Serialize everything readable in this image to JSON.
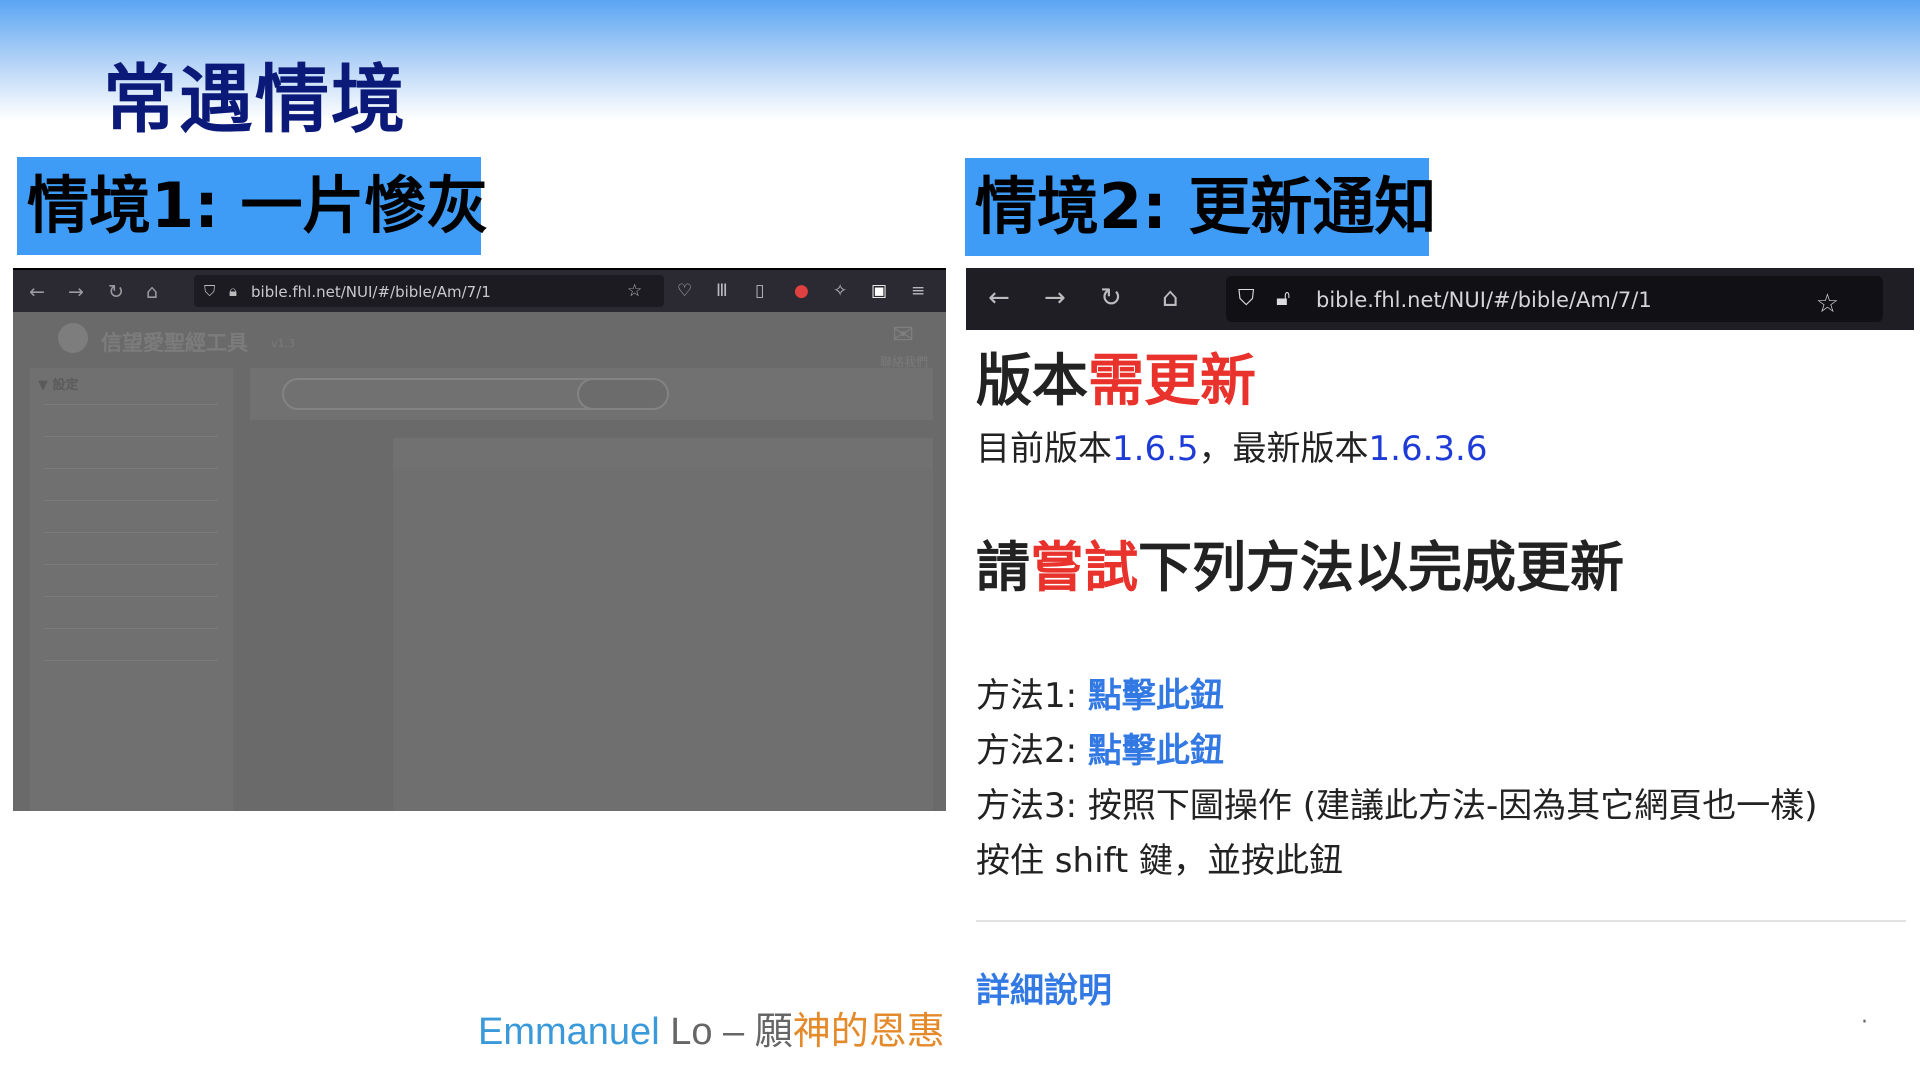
{
  "slide": {
    "title": "常遇情境",
    "label1": "情境1: 一片慘灰",
    "label2": "情境2: 更新通知"
  },
  "shot1": {
    "url": "bible.fhl.net/NUI/#/bible/Am/7/1",
    "app_title": "信望愛聖經工具",
    "version": "v1.3",
    "mail_label": "聯絡我們",
    "sidebar_title": "▼ 設定"
  },
  "shot2": {
    "url": "bible.fhl.net/NUI/#/bible/Am/7/1",
    "heading_prefix": "版本",
    "heading_red": "需更新",
    "current_label": "目前版本",
    "current_version": "1.6.5",
    "separator": "，最新版本",
    "latest_version": "1.6.3.6",
    "try_prefix": "請",
    "try_red": "嘗試",
    "try_suffix": "下列方法以完成更新",
    "method1_label": "方法1: ",
    "method1_link": "點擊此鈕",
    "method2_label": "方法2: ",
    "method2_link": "點擊此鈕",
    "method3": "方法3: 按照下圖操作 (建議此方法-因為其它網頁也一樣)",
    "shift_hint": "按住 shift 鍵，並按此鈕",
    "detail_link": "詳細說明"
  },
  "footer": {
    "name": "Emmanuel",
    "surname": "Lo",
    "dash": "–",
    "wish_start": "願",
    "grace": "神的恩惠"
  },
  "colors": {
    "title": "#0b1a78",
    "label_bg": "#3e9cf7",
    "red": "#e8322b",
    "version_blue": "#1e3bd8",
    "link_blue": "#3279e4"
  }
}
